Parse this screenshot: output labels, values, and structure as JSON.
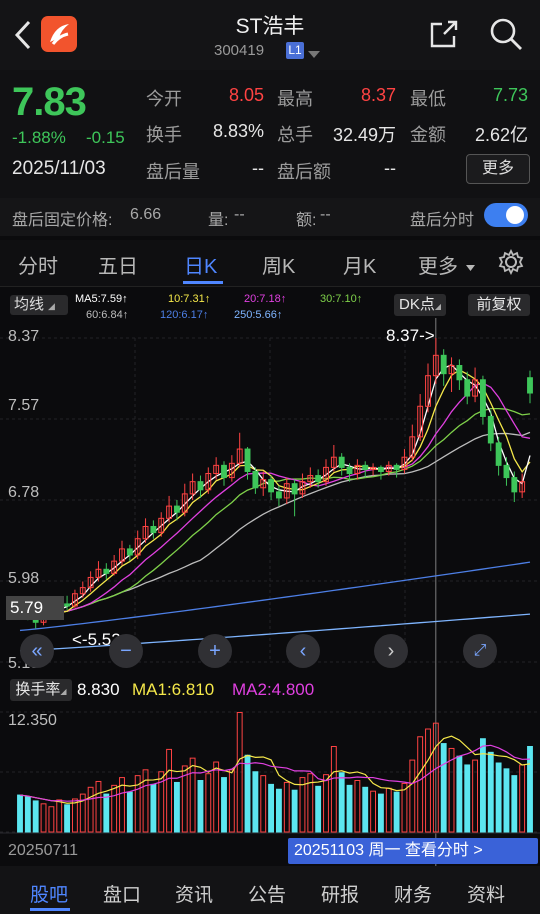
{
  "header": {
    "title": "ST浩丰",
    "code": "300419",
    "level": "L1"
  },
  "quote": {
    "price": "7.83",
    "change_pct": "-1.88%",
    "change": "-0.15",
    "date": "2025/11/03",
    "open_label": "今开",
    "open": "8.05",
    "high_label": "最高",
    "high": "8.37",
    "low_label": "最低",
    "low": "7.73",
    "turnover_label": "换手",
    "turnover": "8.83%",
    "volume_label": "总手",
    "volume": "32.49万",
    "amount_label": "金额",
    "amount": "2.62亿",
    "after_vol_label": "盘后量",
    "after_vol": "--",
    "after_amt_label": "盘后额",
    "after_amt": "--",
    "more": "更多"
  },
  "after_hours": {
    "fixed_price_label": "盘后固定价格:",
    "fixed_price": "6.66",
    "qty_label": "量:",
    "qty": "--",
    "amt_label": "额:",
    "amt": "--",
    "timeshare_label": "盘后分时"
  },
  "tabs": [
    "分时",
    "五日",
    "日K",
    "周K",
    "月K",
    "更多"
  ],
  "ma_row": {
    "selector": "均线",
    "ma5": "MA5:7.59↑",
    "ma10": "10:7.31↑",
    "ma20": "20:7.18↑",
    "ma30": "30:7.10↑",
    "ma60": "60:6.84↑",
    "ma120": "120:6.17↑",
    "ma250": "250:5.66↑",
    "dk": "DK点",
    "adjust": "前复权"
  },
  "chart_axis": {
    "y1": "8.37",
    "y2": "7.57",
    "y3": "6.78",
    "y4": "5.98",
    "y5": "5.19",
    "high_marker": "8.37->",
    "low_marker": "<-5.52",
    "price_tag": "5.79"
  },
  "volume": {
    "selector": "换手率",
    "value": "8.830",
    "ma1": "MA1:6.810",
    "ma2": "MA2:4.800",
    "ymax": "12.350",
    "start_date": "20250711",
    "end_info": "20251103 周一 查看分时 >"
  },
  "nav": [
    "股吧",
    "盘口",
    "资讯",
    "公告",
    "研报",
    "财务",
    "资料"
  ],
  "colors": {
    "up": "#ff4343",
    "down": "#3ec65a",
    "accent": "#4f86ff",
    "ma5": "#ffffff",
    "ma10": "#f5e84a",
    "ma20": "#e040e0",
    "ma30": "#7fd14a",
    "ma60": "#bdbdbd",
    "ma120": "#4d7fe6",
    "ma250": "#7fb5ff",
    "volume": "#5ce6f0"
  },
  "chart_data": {
    "type": "candlestick",
    "ylim": [
      5.19,
      8.37
    ],
    "candles": [
      [
        5.8,
        5.72,
        5.82,
        5.66
      ],
      [
        5.72,
        5.66,
        5.76,
        5.6
      ],
      [
        5.66,
        5.58,
        5.7,
        5.52
      ],
      [
        5.58,
        5.66,
        5.72,
        5.55
      ],
      [
        5.66,
        5.7,
        5.74,
        5.62
      ],
      [
        5.7,
        5.76,
        5.8,
        5.66
      ],
      [
        5.76,
        5.74,
        5.84,
        5.7
      ],
      [
        5.74,
        5.86,
        5.9,
        5.72
      ],
      [
        5.86,
        5.92,
        5.98,
        5.82
      ],
      [
        5.92,
        6.02,
        6.08,
        5.88
      ],
      [
        6.02,
        6.1,
        6.18,
        5.98
      ],
      [
        6.1,
        6.06,
        6.16,
        6.0
      ],
      [
        6.06,
        6.18,
        6.24,
        6.04
      ],
      [
        6.18,
        6.3,
        6.38,
        6.14
      ],
      [
        6.3,
        6.24,
        6.34,
        6.18
      ],
      [
        6.24,
        6.4,
        6.48,
        6.2
      ],
      [
        6.4,
        6.52,
        6.6,
        6.36
      ],
      [
        6.52,
        6.46,
        6.58,
        6.4
      ],
      [
        6.46,
        6.6,
        6.66,
        6.42
      ],
      [
        6.6,
        6.72,
        6.82,
        6.56
      ],
      [
        6.72,
        6.66,
        6.78,
        6.58
      ],
      [
        6.66,
        6.84,
        6.94,
        6.62
      ],
      [
        6.84,
        6.96,
        7.04,
        6.78
      ],
      [
        6.96,
        6.88,
        7.02,
        6.8
      ],
      [
        6.88,
        7.04,
        7.1,
        6.84
      ],
      [
        7.04,
        7.12,
        7.2,
        6.98
      ],
      [
        7.12,
        7.0,
        7.16,
        6.92
      ],
      [
        7.0,
        7.14,
        7.22,
        6.96
      ],
      [
        7.14,
        7.28,
        7.44,
        7.1
      ],
      [
        7.28,
        7.06,
        7.3,
        6.98
      ],
      [
        7.06,
        6.9,
        7.1,
        6.84
      ],
      [
        6.9,
        6.98,
        7.06,
        6.82
      ],
      [
        6.98,
        6.86,
        7.02,
        6.78
      ],
      [
        6.86,
        6.8,
        6.92,
        6.72
      ],
      [
        6.8,
        6.94,
        7.0,
        6.74
      ],
      [
        6.94,
        6.84,
        6.98,
        6.62
      ],
      [
        6.84,
        6.96,
        7.04,
        6.8
      ],
      [
        6.96,
        7.02,
        7.1,
        6.9
      ],
      [
        7.02,
        6.96,
        7.08,
        6.9
      ],
      [
        6.96,
        7.1,
        7.18,
        6.92
      ],
      [
        7.1,
        7.2,
        7.32,
        7.06
      ],
      [
        7.2,
        7.1,
        7.24,
        7.02
      ],
      [
        7.1,
        7.04,
        7.14,
        6.96
      ],
      [
        7.04,
        7.12,
        7.18,
        6.98
      ],
      [
        7.12,
        7.08,
        7.16,
        7.0
      ],
      [
        7.08,
        7.1,
        7.14,
        7.02
      ],
      [
        7.1,
        7.06,
        7.12,
        6.98
      ],
      [
        7.06,
        7.12,
        7.16,
        7.02
      ],
      [
        7.12,
        7.08,
        7.14,
        7.0
      ],
      [
        7.08,
        7.2,
        7.28,
        7.04
      ],
      [
        7.2,
        7.4,
        7.52,
        7.16
      ],
      [
        7.4,
        7.7,
        7.82,
        7.36
      ],
      [
        7.7,
        8.0,
        8.12,
        7.64
      ],
      [
        8.0,
        8.2,
        8.37,
        7.92
      ],
      [
        8.2,
        8.02,
        8.26,
        7.9
      ],
      [
        8.02,
        8.1,
        8.18,
        7.84
      ],
      [
        8.1,
        7.96,
        8.16,
        7.86
      ],
      [
        7.96,
        7.8,
        8.04,
        7.72
      ],
      [
        7.8,
        7.96,
        8.08,
        7.74
      ],
      [
        7.96,
        7.6,
        8.0,
        7.52
      ],
      [
        7.6,
        7.34,
        7.66,
        7.26
      ],
      [
        7.34,
        7.12,
        7.4,
        7.02
      ],
      [
        7.12,
        7.0,
        7.2,
        6.92
      ],
      [
        7.0,
        6.86,
        7.06,
        6.76
      ],
      [
        6.86,
        6.96,
        7.04,
        6.8
      ],
      [
        7.98,
        7.83,
        8.05,
        7.73
      ]
    ],
    "turnover": [
      3.8,
      3.6,
      3.2,
      2.9,
      2.6,
      3.3,
      2.8,
      3.4,
      3.9,
      4.6,
      5.2,
      3.9,
      4.8,
      5.6,
      4.1,
      5.8,
      6.4,
      4.9,
      6.2,
      8.5,
      5.1,
      6.8,
      7.6,
      5.3,
      6.0,
      7.2,
      5.6,
      6.4,
      12.3,
      7.9,
      6.2,
      5.8,
      4.9,
      4.4,
      5.1,
      4.3,
      5.6,
      6.0,
      4.7,
      5.9,
      8.8,
      6.1,
      4.8,
      5.3,
      4.6,
      4.2,
      3.9,
      4.5,
      4.1,
      5.0,
      7.4,
      9.8,
      10.6,
      11.2,
      9.1,
      8.6,
      7.8,
      6.9,
      7.4,
      9.6,
      8.2,
      7.1,
      6.5,
      5.8,
      6.9,
      8.8
    ]
  }
}
